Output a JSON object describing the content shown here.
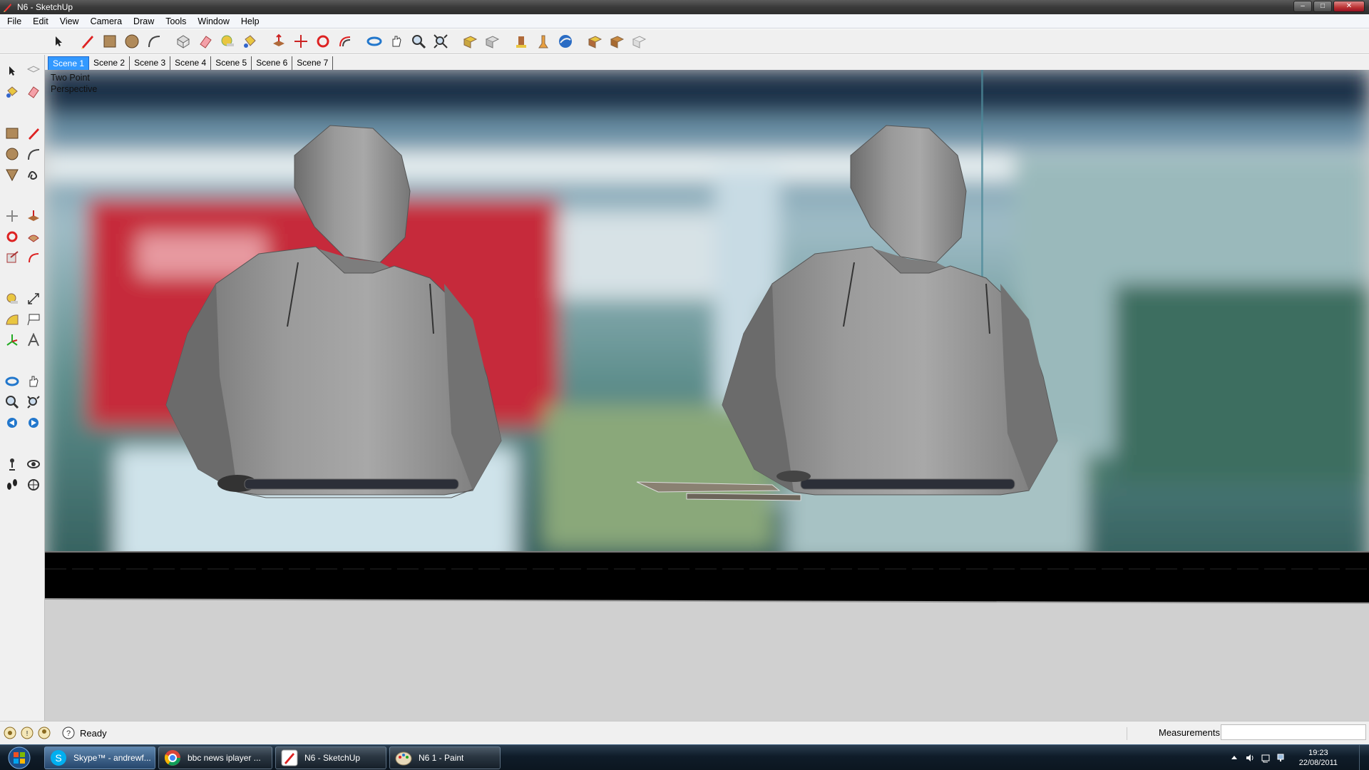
{
  "window": {
    "title": "N6 - SketchUp",
    "minimize": "–",
    "maximize": "□",
    "close": "✕"
  },
  "menu": [
    "File",
    "Edit",
    "View",
    "Camera",
    "Draw",
    "Tools",
    "Window",
    "Help"
  ],
  "toolbar_icons": [
    "select-icon",
    "pencil-line-icon",
    "rectangle-icon",
    "circle-icon",
    "arc-icon",
    "make-component-icon",
    "eraser-icon",
    "tape-measure-icon",
    "paint-bucket-icon",
    "push-pull-icon",
    "move-icon",
    "rotate-icon",
    "offset-icon",
    "orbit-icon",
    "pan-icon",
    "zoom-icon",
    "zoom-extents-icon",
    "get-models-icon",
    "share-model-icon",
    "get-photo-texture-icon",
    "add-location-icon",
    "google-earth-icon",
    "share-component-icon",
    "component-browser-icon",
    "3d-warehouse-icon"
  ],
  "scenes": {
    "tabs": [
      "Scene 1",
      "Scene 2",
      "Scene 3",
      "Scene 4",
      "Scene 5",
      "Scene 6",
      "Scene 7"
    ],
    "active": "Scene 1"
  },
  "viewport": {
    "label_line1": "Two Point",
    "label_line2": "Perspective"
  },
  "status": {
    "text": "Ready",
    "measurements_label": "Measurements",
    "measurements_value": ""
  },
  "taskbar": {
    "tasks": [
      {
        "label": "Skype™ - andrewf...",
        "icon": "skype-icon"
      },
      {
        "label": "bbc news iplayer ...",
        "icon": "chrome-icon"
      },
      {
        "label": "N6 - SketchUp",
        "icon": "sketchup-icon"
      },
      {
        "label": "N6 1 - Paint",
        "icon": "paint-icon"
      }
    ],
    "clock_time": "19:23",
    "clock_date": "22/08/2011"
  }
}
